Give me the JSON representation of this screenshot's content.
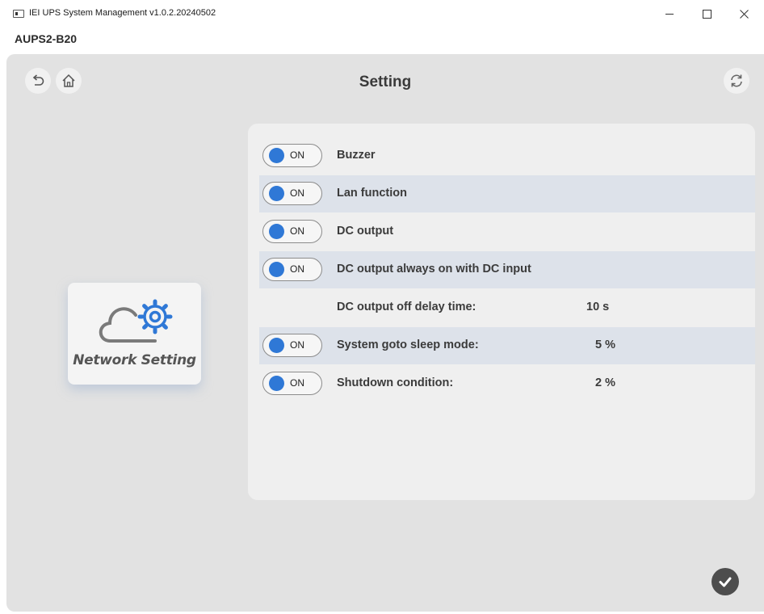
{
  "window": {
    "title": "IEI UPS System Management  v1.0.2.20240502",
    "subtitle": "AUPS2-B20"
  },
  "page": {
    "title": "Setting"
  },
  "sidebar": {
    "network_card_label": "Network Setting"
  },
  "settings": {
    "rows": [
      {
        "toggle": "ON",
        "label": "Buzzer",
        "value": ""
      },
      {
        "toggle": "ON",
        "label": "Lan function",
        "value": ""
      },
      {
        "toggle": "ON",
        "label": "DC output",
        "value": ""
      },
      {
        "toggle": "ON",
        "label": "DC output always on with DC input",
        "value": ""
      },
      {
        "toggle": "",
        "label": "DC output off delay time:",
        "value": "10 s"
      },
      {
        "toggle": "ON",
        "label": "System goto sleep mode:",
        "value": "5 %"
      },
      {
        "toggle": "ON",
        "label": "Shutdown condition:",
        "value": "2 %"
      }
    ]
  },
  "icons": {
    "back": "undo-arrow-icon",
    "home": "home-icon",
    "refresh": "refresh-icon",
    "network": "cloud-gear-icon",
    "confirm": "checkmark-icon"
  },
  "colors": {
    "toggle_knob": "#2f78d6",
    "panel_bg": "#e2e2e2",
    "row_shade": "#dde2ea"
  }
}
